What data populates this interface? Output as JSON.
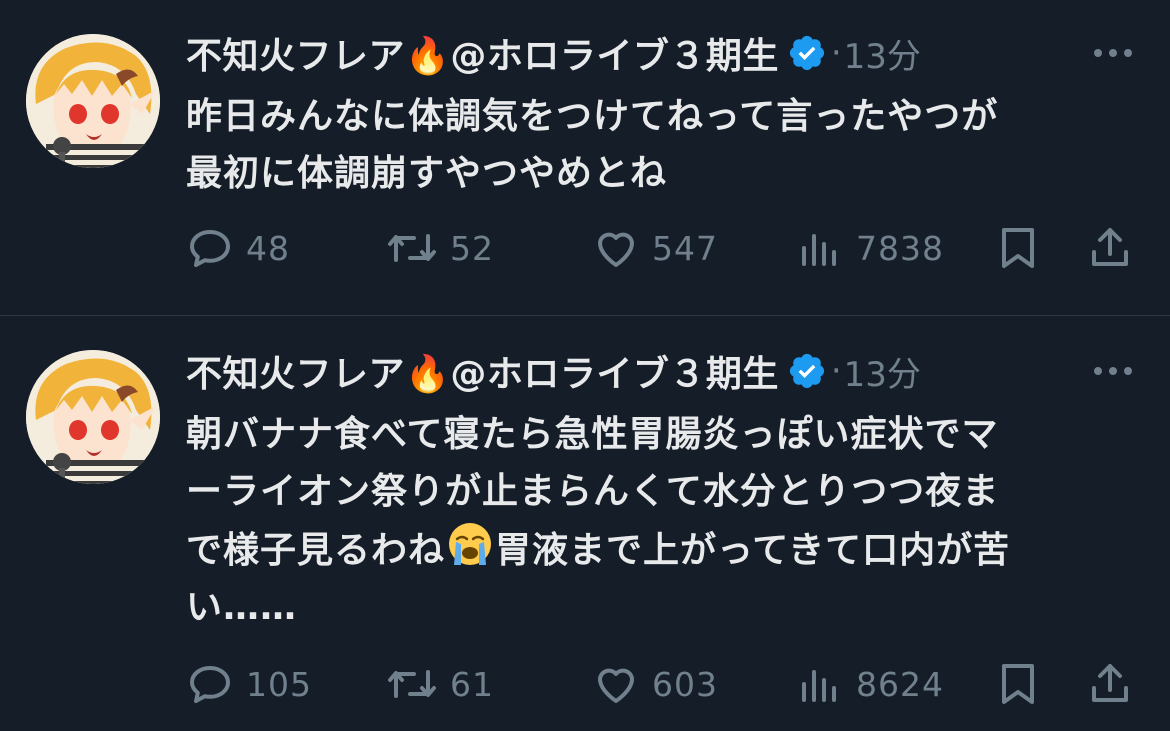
{
  "colors": {
    "background": "#151d28",
    "text": "#e7e9ea",
    "muted": "#71808d",
    "verified": "#1d9bf0",
    "divider": "#2f3842"
  },
  "tweets": [
    {
      "author": "不知火フレア🔥@ホロライブ３期生",
      "time_sep": "·",
      "time": "13分",
      "lines": [
        "昨日みんなに体調気をつけてねって言ったやつが",
        "最初に体調崩すやつやめとね"
      ],
      "stats": {
        "replies": "48",
        "retweets": "52",
        "likes": "547",
        "views": "7838"
      }
    },
    {
      "author": "不知火フレア🔥@ホロライブ３期生",
      "time_sep": "·",
      "time": "13分",
      "lines": [
        "朝バナナ食べて寝たら急性胃腸炎っぽい症状でマ",
        "ーライオン祭りが止まらんくて水分とりつつ夜ま",
        "で様子見るわね",
        "胃液まで上がってきて口内が苦",
        "い……"
      ],
      "stats": {
        "replies": "105",
        "retweets": "61",
        "likes": "603",
        "views": "8624"
      }
    }
  ],
  "icons": [
    "verified-badge-icon",
    "more-icon",
    "reply-icon",
    "retweet-icon",
    "like-icon",
    "views-icon",
    "bookmark-icon",
    "share-icon",
    "loudly-crying-face-emoji"
  ]
}
